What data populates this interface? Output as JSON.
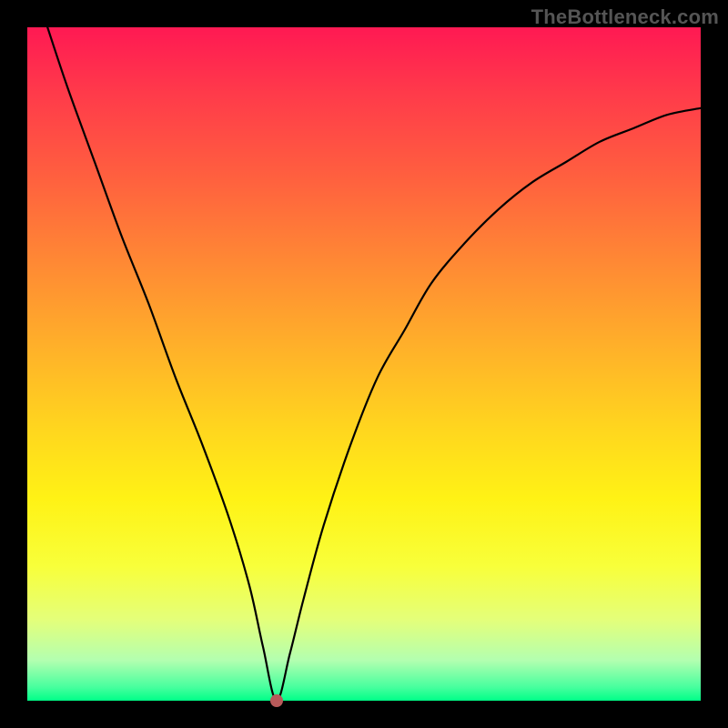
{
  "watermark": "TheBottleneck.com",
  "colors": {
    "frame": "#000000",
    "dot": "#b85a5a",
    "curve": "#000000"
  },
  "chart_data": {
    "type": "line",
    "title": "",
    "xlabel": "",
    "ylabel": "",
    "xlim": [
      0,
      100
    ],
    "ylim": [
      0,
      100
    ],
    "grid": false,
    "minimum_point": {
      "x": 37,
      "y": 0
    },
    "series": [
      {
        "name": "bottleneck-curve",
        "x": [
          3,
          6,
          10,
          14,
          18,
          22,
          26,
          30,
          33,
          35,
          37,
          39,
          41,
          44,
          48,
          52,
          56,
          60,
          65,
          70,
          75,
          80,
          85,
          90,
          95,
          100
        ],
        "values": [
          100,
          91,
          80,
          69,
          59,
          48,
          38,
          27,
          17,
          8,
          0,
          7,
          15,
          26,
          38,
          48,
          55,
          62,
          68,
          73,
          77,
          80,
          83,
          85,
          87,
          88
        ]
      }
    ],
    "background_gradient": [
      {
        "stop": 0,
        "color": "#ff1953"
      },
      {
        "stop": 10,
        "color": "#ff3b4a"
      },
      {
        "stop": 22,
        "color": "#ff5f3f"
      },
      {
        "stop": 35,
        "color": "#ff8934"
      },
      {
        "stop": 48,
        "color": "#ffb229"
      },
      {
        "stop": 60,
        "color": "#ffd71e"
      },
      {
        "stop": 70,
        "color": "#fff215"
      },
      {
        "stop": 80,
        "color": "#f8ff3a"
      },
      {
        "stop": 88,
        "color": "#e4ff7a"
      },
      {
        "stop": 94,
        "color": "#b3ffb0"
      },
      {
        "stop": 98,
        "color": "#47ff9e"
      },
      {
        "stop": 100,
        "color": "#00ff88"
      }
    ]
  }
}
